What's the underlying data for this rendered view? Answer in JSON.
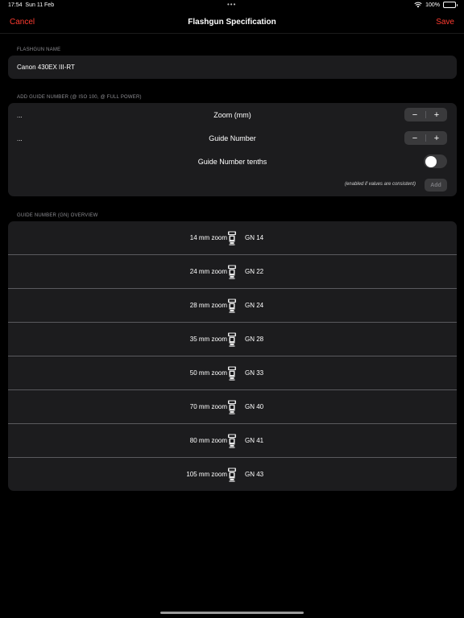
{
  "status_bar": {
    "time": "17:54",
    "date": "Sun 11 Feb",
    "dots": "•••",
    "battery": "100%"
  },
  "nav": {
    "cancel_label": "Cancel",
    "title": "Flashgun Specification",
    "save_label": "Save"
  },
  "flashgun_name": {
    "header": "FLASHGUN NAME",
    "value": "Canon 430EX III-RT"
  },
  "guide_number": {
    "header": "ADD GUIDE NUMBER (@ ISO 100, @ FULL POWER)",
    "zoom": {
      "value": "...",
      "label": "Zoom (mm)",
      "minus": "−",
      "plus": "+"
    },
    "gn": {
      "value": "...",
      "label": "Guide Number",
      "minus": "−",
      "plus": "+"
    },
    "tenths": {
      "label": "Guide Number tenths",
      "enabled": false
    },
    "hint": "(enabled if values are consistent)",
    "add_label": "Add"
  },
  "overview": {
    "header": "GUIDE NUMBER (GN) OVERVIEW",
    "rows": [
      {
        "zoom": "14 mm zoom",
        "gn": "GN 14"
      },
      {
        "zoom": "24 mm zoom",
        "gn": "GN 22"
      },
      {
        "zoom": "28 mm zoom",
        "gn": "GN 24"
      },
      {
        "zoom": "35 mm zoom",
        "gn": "GN 28"
      },
      {
        "zoom": "50 mm zoom",
        "gn": "GN 33"
      },
      {
        "zoom": "70 mm zoom",
        "gn": "GN 40"
      },
      {
        "zoom": "80 mm zoom",
        "gn": "GN 41"
      },
      {
        "zoom": "105 mm zoom",
        "gn": "GN 43"
      }
    ]
  },
  "colors": {
    "accent": "#ff3b30",
    "background": "#000000",
    "card": "#1c1c1e",
    "control": "#3a3a3c"
  },
  "icons": {
    "row_icon": "flashgun-icon",
    "wifi": "wifi-icon",
    "battery": "battery-icon"
  }
}
